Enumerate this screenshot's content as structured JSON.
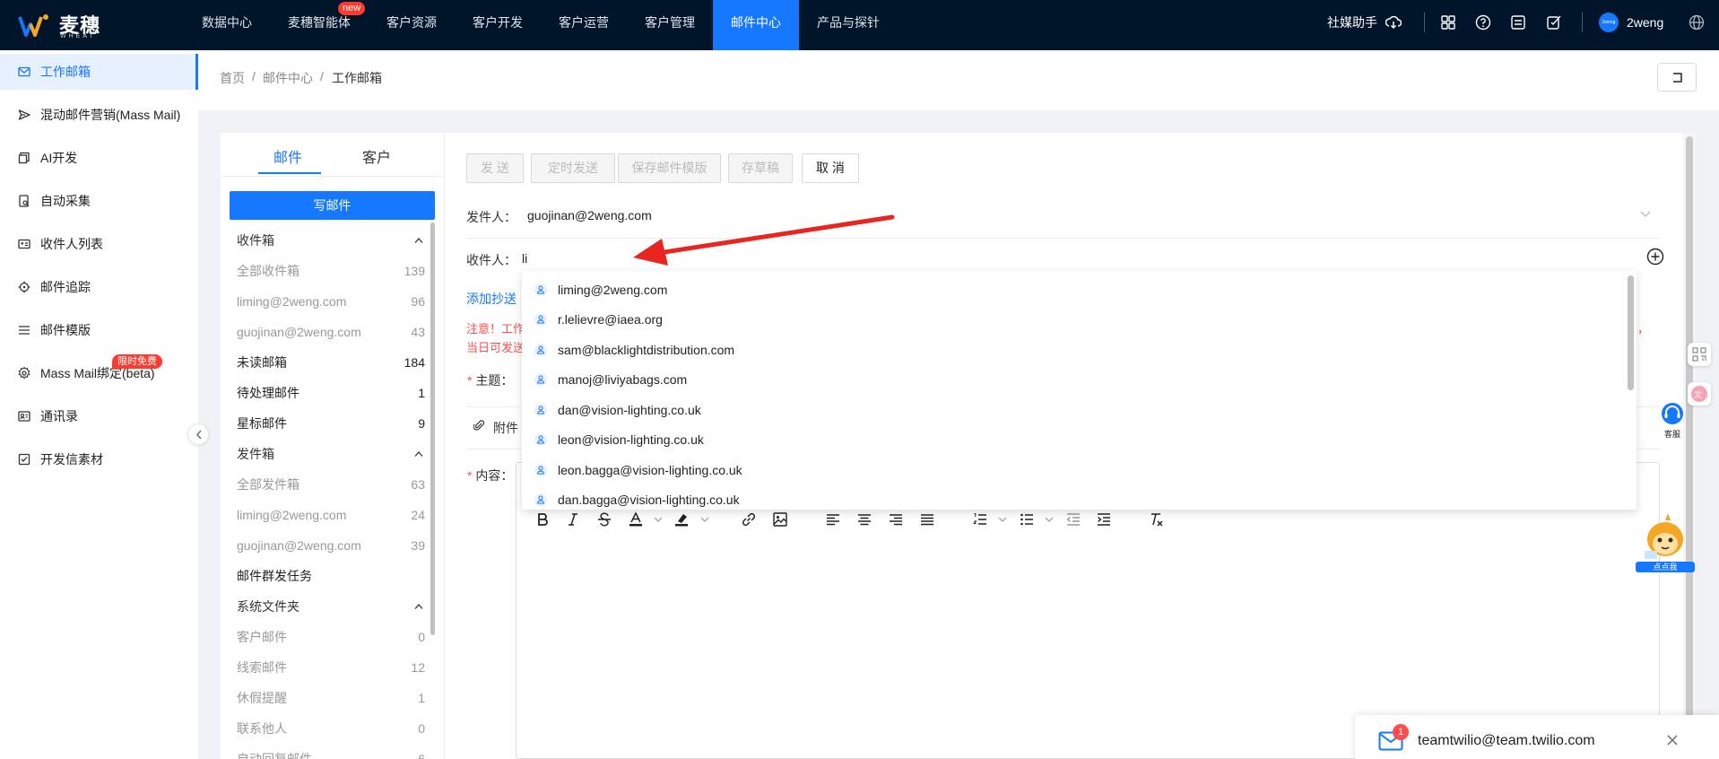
{
  "app": {
    "logo_text": "麦穗",
    "logo_sub": "WHEAT"
  },
  "topnav": {
    "items": [
      {
        "label": "数据中心"
      },
      {
        "label": "麦穗智能体",
        "badge": "new"
      },
      {
        "label": "客户资源"
      },
      {
        "label": "客户开发"
      },
      {
        "label": "客户运营"
      },
      {
        "label": "客户管理"
      },
      {
        "label": "邮件中心",
        "active": true
      },
      {
        "label": "产品与探针"
      }
    ],
    "social_helper": "社媒助手",
    "user_avatar_text": "2weng",
    "user_name": "2weng"
  },
  "sidebar": {
    "items": [
      {
        "label": "工作邮箱",
        "icon": "mail-icon",
        "active": true
      },
      {
        "label": "混动邮件营销(Mass Mail)",
        "icon": "send-icon"
      },
      {
        "label": "AI开发",
        "icon": "copy-icon"
      },
      {
        "label": "自动采集",
        "icon": "doc-search-icon"
      },
      {
        "label": "收件人列表",
        "icon": "id-card-icon"
      },
      {
        "label": "邮件追踪",
        "icon": "target-icon"
      },
      {
        "label": "邮件模版",
        "icon": "list-icon"
      },
      {
        "label": "Mass Mail绑定(beta)",
        "icon": "gear-icon",
        "badge": "限时免费"
      },
      {
        "label": "通讯录",
        "icon": "contacts-icon"
      },
      {
        "label": "开发信素材",
        "icon": "checklist-icon"
      }
    ]
  },
  "breadcrumb": [
    "首页",
    "/",
    "邮件中心",
    "/",
    "工作邮箱"
  ],
  "folders": {
    "tabs": [
      "邮件",
      "客户"
    ],
    "compose_label": "写邮件",
    "rows": [
      {
        "label": "收件箱",
        "kind": "head",
        "chevron": true
      },
      {
        "label": "全部收件箱",
        "count": "139",
        "kind": "grey"
      },
      {
        "label": "liming@2weng.com",
        "count": "96",
        "kind": "grey"
      },
      {
        "label": "guojinan@2weng.com",
        "count": "43",
        "kind": "grey"
      },
      {
        "label": "未读邮箱",
        "count": "184",
        "kind": "dark"
      },
      {
        "label": "待处理邮件",
        "count": "1",
        "kind": "dark"
      },
      {
        "label": "星标邮件",
        "count": "9",
        "kind": "dark"
      },
      {
        "label": "发件箱",
        "kind": "head",
        "chevron": true
      },
      {
        "label": "全部发件箱",
        "count": "63",
        "kind": "grey"
      },
      {
        "label": "liming@2weng.com",
        "count": "24",
        "kind": "grey"
      },
      {
        "label": "guojinan@2weng.com",
        "count": "39",
        "kind": "grey"
      },
      {
        "label": "邮件群发任务",
        "kind": "dark"
      },
      {
        "label": "系统文件夹",
        "kind": "head",
        "chevron": true
      },
      {
        "label": "客户邮件",
        "count": "0",
        "kind": "grey"
      },
      {
        "label": "线索邮件",
        "count": "12",
        "kind": "grey"
      },
      {
        "label": "休假提醒",
        "count": "1",
        "kind": "grey"
      },
      {
        "label": "联系他人",
        "count": "0",
        "kind": "grey"
      },
      {
        "label": "自动回复邮件",
        "count": "6",
        "kind": "grey"
      }
    ]
  },
  "compose": {
    "buttons": {
      "send": "发 送",
      "schedule": "定时发送",
      "save_template": "保存邮件模版",
      "save_draft": "存草稿",
      "cancel": "取 消"
    },
    "from_label": "发件人：",
    "from_value": "guojinan@2weng.com",
    "to_label": "收件人：",
    "to_value": "li",
    "add_cc": "添加抄送",
    "warning_line1": "注意！工作",
    "warning_line1_end": "，",
    "warning_line2": "当日可发送",
    "subject_label": "主题：",
    "attach_label": "附件",
    "content_label": "内容："
  },
  "suggestions": [
    "liming@2weng.com",
    "r.lelievre@iaea.org",
    "sam@blacklightdistribution.com",
    "manoj@liviyabags.com",
    "dan@vision-lighting.co.uk",
    "leon@vision-lighting.co.uk",
    "leon.bagga@vision-lighting.co.uk",
    "dan.bagga@vision-lighting.co.uk"
  ],
  "floating": {
    "kefu_label": "客服",
    "mascot_label": "点点我"
  },
  "notification": {
    "email": "teamtwilio@team.twilio.com",
    "badge": "1"
  },
  "colors": {
    "primary": "#1677ff",
    "nav_bg": "#001529",
    "warn": "#ff4d4f",
    "annotation_arrow": "#e8261f"
  }
}
